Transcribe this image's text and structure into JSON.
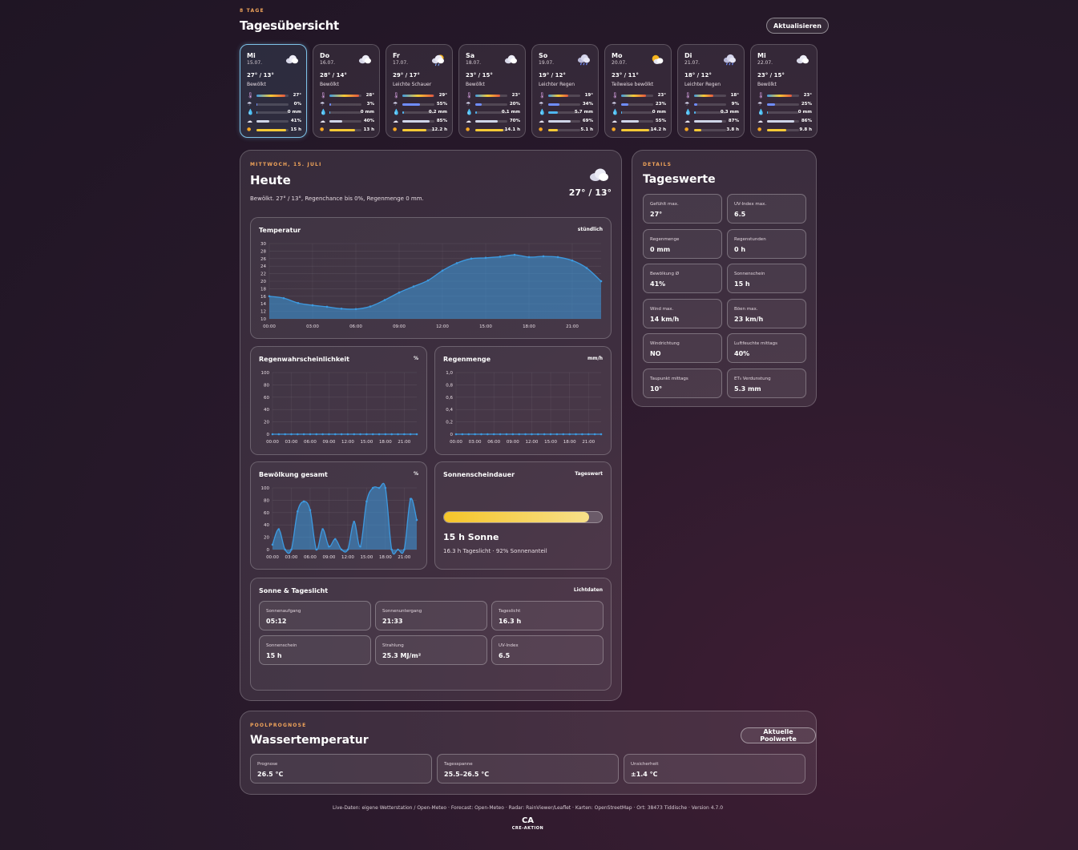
{
  "header": {
    "eyebrow": "8 TAGE",
    "title": "Tagesübersicht",
    "refresh_label": "Aktualisieren"
  },
  "days": [
    {
      "name": "Mi",
      "date": "15.07.",
      "temps": "27° / 13°",
      "cond": "Bewölkt",
      "icon": "cloud-icon",
      "uv": "27°",
      "uv_f": 0.9,
      "rainp": "0%",
      "rainp_f": 0.0,
      "rain": "0 mm",
      "rain_f": 0.0,
      "cloud": "41%",
      "cloud_f": 0.41,
      "sun": "15 h",
      "sun_f": 0.93
    },
    {
      "name": "Do",
      "date": "16.07.",
      "temps": "28° / 14°",
      "cond": "Bewölkt",
      "icon": "cloud-icon",
      "uv": "28°",
      "uv_f": 0.93,
      "rainp": "3%",
      "rainp_f": 0.03,
      "rain": "0 mm",
      "rain_f": 0.0,
      "cloud": "40%",
      "cloud_f": 0.4,
      "sun": "13 h",
      "sun_f": 0.8
    },
    {
      "name": "Fr",
      "date": "17.07.",
      "temps": "29° / 17°",
      "cond": "Leichte Schauer",
      "icon": "sun-rain-icon",
      "uv": "29°",
      "uv_f": 0.97,
      "rainp": "55%",
      "rainp_f": 0.55,
      "rain": "0.2 mm",
      "rain_f": 0.05,
      "cloud": "85%",
      "cloud_f": 0.85,
      "sun": "12.2 h",
      "sun_f": 0.75
    },
    {
      "name": "Sa",
      "date": "18.07.",
      "temps": "23° / 15°",
      "cond": "Bewölkt",
      "icon": "cloud-icon",
      "uv": "23°",
      "uv_f": 0.77,
      "rainp": "20%",
      "rainp_f": 0.2,
      "rain": "0.1 mm",
      "rain_f": 0.03,
      "cloud": "70%",
      "cloud_f": 0.7,
      "sun": "14.1 h",
      "sun_f": 0.87
    },
    {
      "name": "So",
      "date": "19.07.",
      "temps": "19° / 12°",
      "cond": "Leichter Regen",
      "icon": "rain-cloud-icon",
      "uv": "19°",
      "uv_f": 0.63,
      "rainp": "34%",
      "rainp_f": 0.34,
      "rain": "5.7 mm",
      "rain_f": 0.3,
      "cloud": "69%",
      "cloud_f": 0.69,
      "sun": "5.1 h",
      "sun_f": 0.31
    },
    {
      "name": "Mo",
      "date": "20.07.",
      "temps": "23° / 11°",
      "cond": "Teilweise bewölkt",
      "icon": "partly-cloudy-icon",
      "uv": "23°",
      "uv_f": 0.77,
      "rainp": "23%",
      "rainp_f": 0.23,
      "rain": "0 mm",
      "rain_f": 0.0,
      "cloud": "55%",
      "cloud_f": 0.55,
      "sun": "14.2 h",
      "sun_f": 0.88
    },
    {
      "name": "Di",
      "date": "21.07.",
      "temps": "18° / 12°",
      "cond": "Leichter Regen",
      "icon": "rain-cloud-icon",
      "uv": "18°",
      "uv_f": 0.6,
      "rainp": "9%",
      "rainp_f": 0.09,
      "rain": "0.3 mm",
      "rain_f": 0.05,
      "cloud": "87%",
      "cloud_f": 0.87,
      "sun": "3.8 h",
      "sun_f": 0.23
    },
    {
      "name": "Mi",
      "date": "22.07.",
      "temps": "23° / 15°",
      "cond": "Bewölkt",
      "icon": "cloud-icon",
      "uv": "23°",
      "uv_f": 0.77,
      "rainp": "25%",
      "rainp_f": 0.25,
      "rain": "0 mm",
      "rain_f": 0.0,
      "cloud": "86%",
      "cloud_f": 0.86,
      "sun": "9.8 h",
      "sun_f": 0.6
    }
  ],
  "today": {
    "eyebrow": "MITTWOCH, 15. JULI",
    "title": "Heute",
    "summary": "Bewölkt. 27° / 13°, Regenchance bis 0%, Regenmenge 0 mm.",
    "temps": "27° / 13°",
    "icon": "cloud-icon"
  },
  "details": {
    "eyebrow": "DETAILS",
    "title": "Tageswerte",
    "tiles": [
      {
        "label": "Gefühlt max.",
        "value": "27°"
      },
      {
        "label": "UV-Index max.",
        "value": "6.5"
      },
      {
        "label": "Regenmenge",
        "value": "0 mm"
      },
      {
        "label": "Regenstunden",
        "value": "0 h"
      },
      {
        "label": "Bewölkung Ø",
        "value": "41%"
      },
      {
        "label": "Sonnenschein",
        "value": "15 h"
      },
      {
        "label": "Wind max.",
        "value": "14 km/h"
      },
      {
        "label": "Böen max.",
        "value": "23 km/h"
      },
      {
        "label": "Windrichtung",
        "value": "NO"
      },
      {
        "label": "Luftfeuchte mittags",
        "value": "40%"
      },
      {
        "label": "Taupunkt mittags",
        "value": "10°"
      },
      {
        "label": "ET₀ Verdunstung",
        "value": "5.3 mm"
      }
    ]
  },
  "sunshine": {
    "title": "Sonnenscheindauer",
    "unit": "Tageswert",
    "value": "15 h Sonne",
    "sub": "16.3 h Tageslicht · 92% Sonnenanteil",
    "fraction": 0.92
  },
  "daylight": {
    "title": "Sonne & Tageslicht",
    "unit": "Lichtdaten",
    "tiles": [
      {
        "label": "Sonnenaufgang",
        "value": "05:12"
      },
      {
        "label": "Sonnenuntergang",
        "value": "21:33"
      },
      {
        "label": "Tageslicht",
        "value": "16.3 h"
      },
      {
        "label": "Sonnenschein",
        "value": "15 h"
      },
      {
        "label": "Strahlung",
        "value": "25.3 MJ/m²"
      },
      {
        "label": "UV-Index",
        "value": "6.5"
      }
    ]
  },
  "pool": {
    "eyebrow": "POOLPROGNOSE",
    "title": "Wassertemperatur",
    "button": "Aktuelle Poolwerte",
    "tiles": [
      {
        "label": "Prognose",
        "value": "26.5 °C"
      },
      {
        "label": "Tagesspanne",
        "value": "25.5–26.5 °C"
      },
      {
        "label": "Unsicherheit",
        "value": "±1.4 °C"
      }
    ]
  },
  "footer": {
    "text": "Live-Daten: eigene Wetterstation / Open-Meteo · Forecast: Open-Meteo · Radar: RainViewer/Leaflet · Karten: OpenStreetMap · Ort: 38473 Tiddische · Version 4.7.0",
    "logo_text": "CRE-AKTION",
    "logo_mark": "CA"
  },
  "colors": {
    "accent": "#f0a45a",
    "series": "#3d9ae0",
    "sun": "#f5c935"
  },
  "chart_data": [
    {
      "id": "temp",
      "type": "area",
      "title": "Temperatur",
      "unit": "stündlich",
      "x": [
        "00:00",
        "01:00",
        "02:00",
        "03:00",
        "04:00",
        "05:00",
        "06:00",
        "07:00",
        "08:00",
        "09:00",
        "10:00",
        "11:00",
        "12:00",
        "13:00",
        "14:00",
        "15:00",
        "16:00",
        "17:00",
        "18:00",
        "19:00",
        "20:00",
        "21:00",
        "22:00",
        "23:00"
      ],
      "xticks": [
        "00:00",
        "03:00",
        "06:00",
        "09:00",
        "12:00",
        "15:00",
        "18:00",
        "21:00"
      ],
      "values": [
        16,
        15.5,
        14.2,
        13.6,
        13.2,
        12.7,
        12.6,
        13.3,
        15,
        17,
        18.6,
        20.2,
        22.8,
        24.8,
        26,
        26.2,
        26.5,
        27,
        26.4,
        26.6,
        26.4,
        25.5,
        23.5,
        20
      ],
      "ylim": [
        10,
        30
      ],
      "yticks": [
        10,
        12,
        14,
        16,
        18,
        20,
        22,
        24,
        26,
        28,
        30
      ]
    },
    {
      "id": "rainprob",
      "type": "line",
      "title": "Regenwahrscheinlichkeit",
      "unit": "%",
      "x": [
        "00:00",
        "01:00",
        "02:00",
        "03:00",
        "04:00",
        "05:00",
        "06:00",
        "07:00",
        "08:00",
        "09:00",
        "10:00",
        "11:00",
        "12:00",
        "13:00",
        "14:00",
        "15:00",
        "16:00",
        "17:00",
        "18:00",
        "19:00",
        "20:00",
        "21:00",
        "22:00",
        "23:00"
      ],
      "xticks": [
        "00:00",
        "03:00",
        "06:00",
        "09:00",
        "12:00",
        "15:00",
        "18:00",
        "21:00"
      ],
      "values": [
        0,
        0,
        0,
        0,
        0,
        0,
        0,
        0,
        0,
        0,
        0,
        0,
        0,
        0,
        0,
        0,
        0,
        0,
        0,
        0,
        0,
        0,
        0,
        0
      ],
      "ylim": [
        0,
        100
      ],
      "yticks": [
        0,
        20,
        40,
        60,
        80,
        100
      ]
    },
    {
      "id": "rainamount",
      "type": "line",
      "title": "Regenmenge",
      "unit": "mm/h",
      "x": [
        "00:00",
        "01:00",
        "02:00",
        "03:00",
        "04:00",
        "05:00",
        "06:00",
        "07:00",
        "08:00",
        "09:00",
        "10:00",
        "11:00",
        "12:00",
        "13:00",
        "14:00",
        "15:00",
        "16:00",
        "17:00",
        "18:00",
        "19:00",
        "20:00",
        "21:00",
        "22:00",
        "23:00"
      ],
      "xticks": [
        "00:00",
        "03:00",
        "06:00",
        "09:00",
        "12:00",
        "15:00",
        "18:00",
        "21:00"
      ],
      "values": [
        0,
        0,
        0,
        0,
        0,
        0,
        0,
        0,
        0,
        0,
        0,
        0,
        0,
        0,
        0,
        0,
        0,
        0,
        0,
        0,
        0,
        0,
        0,
        0
      ],
      "ylim": [
        0,
        1
      ],
      "yticks": [
        "0",
        "0,2",
        "0,4",
        "0,6",
        "0,8",
        "1,0"
      ]
    },
    {
      "id": "clouds",
      "type": "area",
      "title": "Bewölkung gesamt",
      "unit": "%",
      "x": [
        "00:00",
        "01:00",
        "02:00",
        "03:00",
        "04:00",
        "05:00",
        "06:00",
        "07:00",
        "08:00",
        "09:00",
        "10:00",
        "11:00",
        "12:00",
        "13:00",
        "14:00",
        "15:00",
        "16:00",
        "17:00",
        "18:00",
        "19:00",
        "20:00",
        "21:00",
        "22:00",
        "23:00"
      ],
      "xticks": [
        "00:00",
        "03:00",
        "06:00",
        "09:00",
        "12:00",
        "15:00",
        "18:00",
        "21:00"
      ],
      "values": [
        8,
        33,
        0,
        0,
        62,
        78,
        64,
        0,
        33,
        5,
        17,
        0,
        0,
        45,
        5,
        78,
        100,
        100,
        100,
        0,
        0,
        0,
        82,
        48
      ],
      "ylim": [
        0,
        100
      ],
      "yticks": [
        0,
        20,
        40,
        60,
        80,
        100
      ]
    }
  ]
}
